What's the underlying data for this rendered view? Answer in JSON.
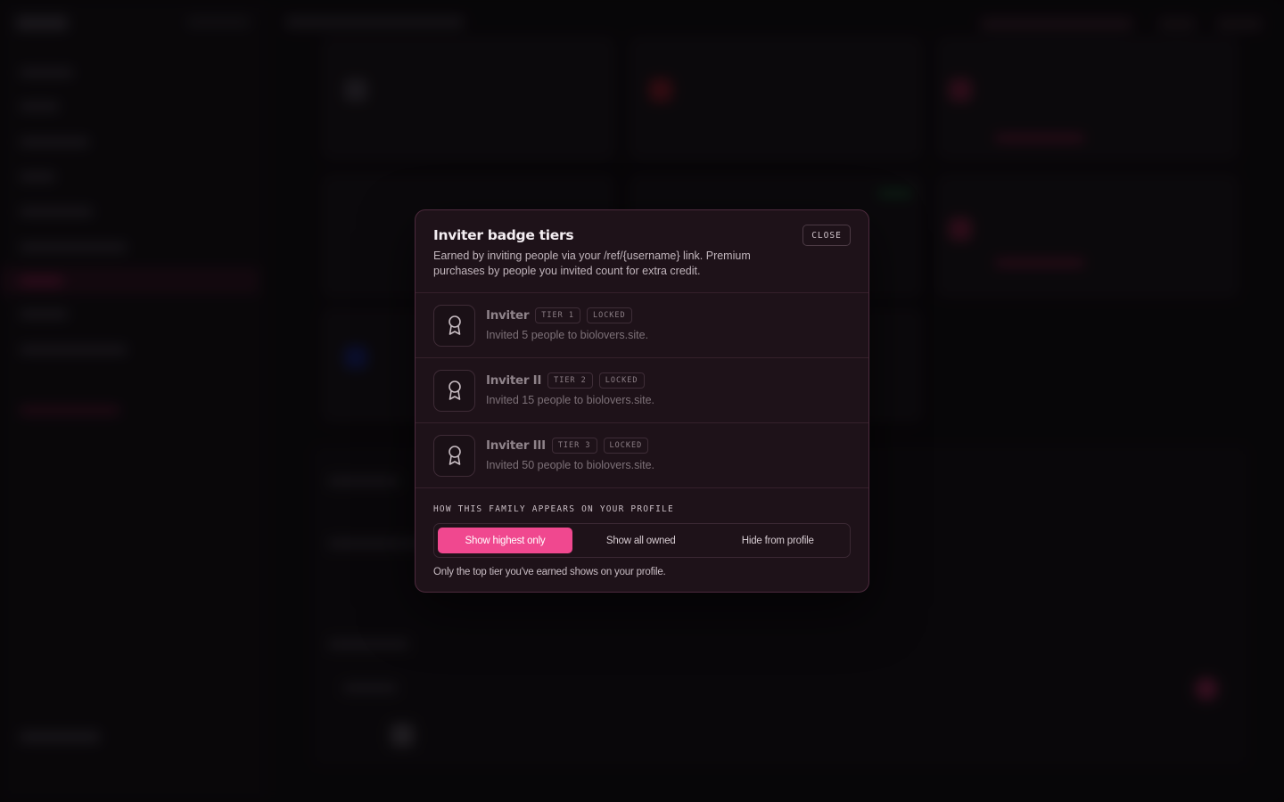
{
  "modal": {
    "title": "Inviter badge tiers",
    "description": "Earned by inviting people via your /ref/{username} link. Premium purchases by people you invited count for extra credit.",
    "close_label": "CLOSE",
    "tiers": [
      {
        "name": "Inviter",
        "tier": "TIER 1",
        "status": "LOCKED",
        "description": "Invited 5 people to biolovers.site.",
        "icon": "award-ribbon-icon"
      },
      {
        "name": "Inviter II",
        "tier": "TIER 2",
        "status": "LOCKED",
        "description": "Invited 15 people to biolovers.site.",
        "icon": "award-ribbon-icon"
      },
      {
        "name": "Inviter III",
        "tier": "TIER 3",
        "status": "LOCKED",
        "description": "Invited 50 people to biolovers.site.",
        "icon": "award-ribbon-icon"
      }
    ],
    "display": {
      "label": "HOW THIS FAMILY APPEARS ON YOUR PROFILE",
      "options": [
        "Show highest only",
        "Show all owned",
        "Hide from profile"
      ],
      "selected": "Show highest only",
      "note": "Only the top tier you've earned shows on your profile."
    }
  },
  "colors": {
    "accent": "#f0488f",
    "modal_bg": "#1e1219",
    "modal_border": "#4d2a3d"
  }
}
